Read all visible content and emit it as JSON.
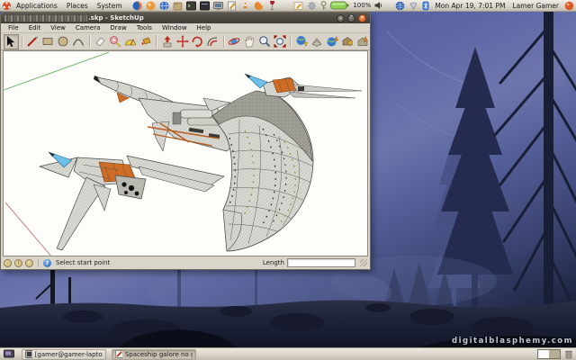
{
  "desktop": {
    "wallpaper": {
      "credit": "digitalblasphemy.com"
    },
    "top_panel": {
      "menus": [
        "Applications",
        "Places",
        "System"
      ],
      "launcher_icons": [
        "firefox",
        "software-ball",
        "web-globe",
        "files",
        "terminal",
        "terminal-alt",
        "display",
        "text-editor",
        "vlc",
        "media-swirl",
        "wine"
      ],
      "indicator_icons": [
        "notes",
        "gear",
        "key",
        "battery",
        "volume",
        "network-globe",
        "wifi",
        "bluetooth",
        "logout"
      ],
      "battery_label": "100%",
      "clock": "Mon Apr 19,  7:01 PM",
      "user": "Lamer Gamer"
    },
    "taskbar": {
      "tasks": [
        {
          "label": "[gamer@gamer-laptop:...",
          "icon": "terminal",
          "active": false
        },
        {
          "label": "Spaceship galore no gr...",
          "icon": "sketchup-pencil",
          "active": true
        }
      ],
      "workspace_count": "2"
    }
  },
  "su_window": {
    "title_suffix": ".skp - SketchUp",
    "window_buttons": [
      "minimize",
      "maximize",
      "close"
    ],
    "menubar": [
      "File",
      "Edit",
      "View",
      "Camera",
      "Draw",
      "Tools",
      "Window",
      "Help"
    ],
    "toolbar_tools": [
      "select",
      "line",
      "rectangle",
      "circle",
      "arc",
      "eraser",
      "tape-measure",
      "protractor",
      "paint-bucket",
      "push-pull",
      "move",
      "rotate",
      "offset",
      "orbit",
      "pan",
      "zoom",
      "zoom-extents",
      "get-current-view",
      "toggle-terrain",
      "share-model",
      "get-models",
      "share-models"
    ],
    "active_tool": "select",
    "statusbar": {
      "status_icons": [
        "geolocation",
        "claim-credit",
        "sign-in"
      ],
      "hint": "Select start point",
      "length_label": "Length",
      "length_value": ""
    },
    "model": "spaceship-3d-model",
    "axes": [
      "green-axis",
      "red-axis"
    ]
  },
  "colors": {
    "panel_bg": "#d9d4ca",
    "titlebar": "#3f3d38",
    "close_button": "#d95b20",
    "canvas": "#fdfdfa",
    "hull_gray": "#d6d6d0",
    "hull_orange": "#cd6d28",
    "spike_blue": "#6cc0ea",
    "sky_blue": "#5c66a6"
  }
}
